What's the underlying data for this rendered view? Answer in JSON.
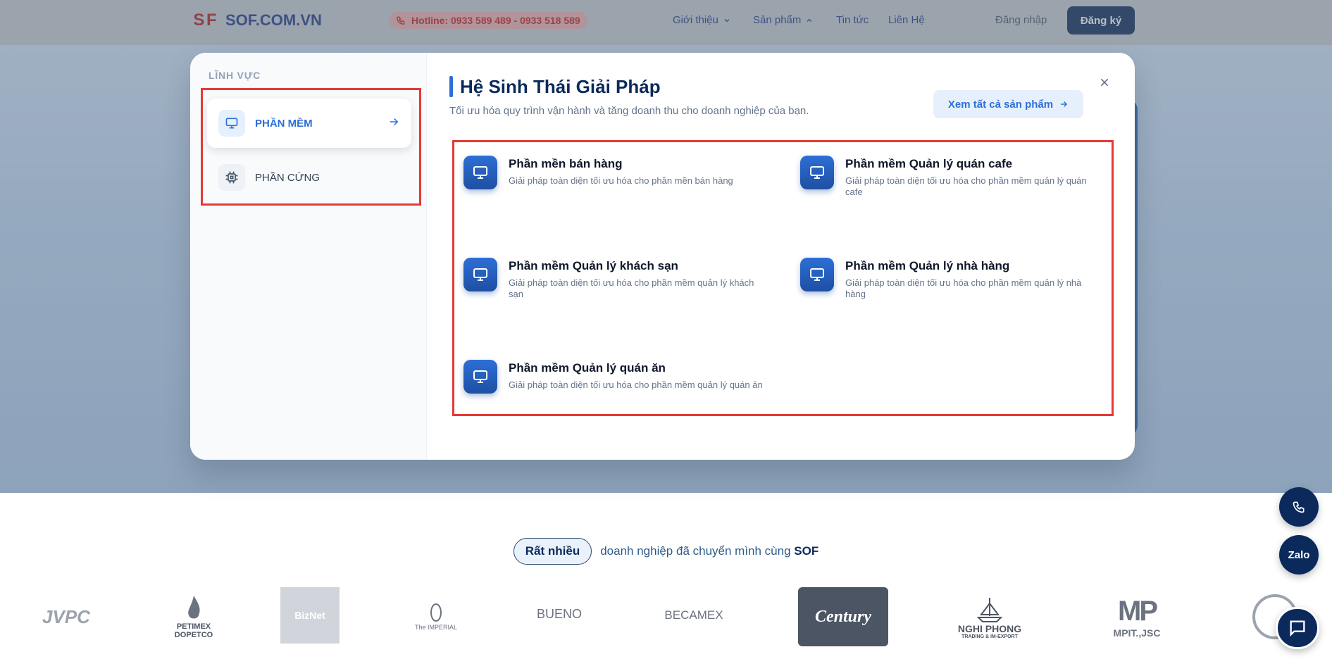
{
  "navbar": {
    "logo_mark": "S F",
    "logo_text": "SOF.COM.VN",
    "hotline": "Hotline: 0933 589 489 - 0933 518 589",
    "links": [
      {
        "label": "Giới thiệu",
        "icon": "chevron-down-icon"
      },
      {
        "label": "Sản phẩm",
        "icon": "chevron-up-icon"
      },
      {
        "label": "Tin tức"
      },
      {
        "label": "Liên Hệ"
      }
    ],
    "login_label": "Đăng nhập",
    "signup_label": "Đăng ký"
  },
  "menu": {
    "sidebar_label": "LĨNH VỰC",
    "sidebar_items": [
      {
        "label": "PHẦN MỀM",
        "icon": "monitor-icon",
        "active": true
      },
      {
        "label": "PHẦN CỨNG",
        "icon": "chip-icon",
        "active": false
      }
    ],
    "title": "Hệ Sinh Thái Giải Pháp",
    "subtitle": "Tối ưu hóa quy trình vận hành và tăng doanh thu cho doanh nghiệp của bạn.",
    "see_all_label": "Xem tất cả sản phẩm",
    "products": [
      {
        "title": "Phần mền bán hàng",
        "desc": "Giải pháp toàn diện tối ưu hóa cho phần mền bán hàng"
      },
      {
        "title": "Phần mềm Quản lý quán cafe",
        "desc": "Giải pháp toàn diện tối ưu hóa cho phần mềm quản lý quán cafe"
      },
      {
        "title": "Phần mềm Quản lý khách sạn",
        "desc": "Giải pháp toàn diện tối ưu hóa cho phần mềm quản lý khách sạn"
      },
      {
        "title": "Phần mềm Quản lý nhà hàng",
        "desc": "Giải pháp toàn diện tối ưu hóa cho phần mềm quản lý nhà hàng"
      },
      {
        "title": "Phần mềm Quản lý quán ăn",
        "desc": "Giải pháp toàn diện tối ưu hóa cho phần mềm quản lý quán ăn"
      }
    ]
  },
  "trust": {
    "pill": "Rất nhiều",
    "text": "doanh nghiệp đã chuyển mình cùng",
    "brand": "SOF"
  },
  "partner_logos": [
    {
      "name": "JVPC"
    },
    {
      "name": "PETIMEX",
      "sub": "DOPETCO"
    },
    {
      "name": "BizNet"
    },
    {
      "name": "The IMPERIAL"
    },
    {
      "name": "BUENO"
    },
    {
      "name": "BECAMEX"
    },
    {
      "name": "Century"
    },
    {
      "name": "NGHI PHONG",
      "sub": "TRADING & IM-EXPORT"
    },
    {
      "name": "MP",
      "sub": "MPIT.,JSC"
    }
  ],
  "floating": {
    "zalo_label": "Zalo"
  },
  "colors": {
    "accent": "#2d6fd6",
    "navy": "#0b2a5b",
    "highlight_border": "#e53935"
  }
}
